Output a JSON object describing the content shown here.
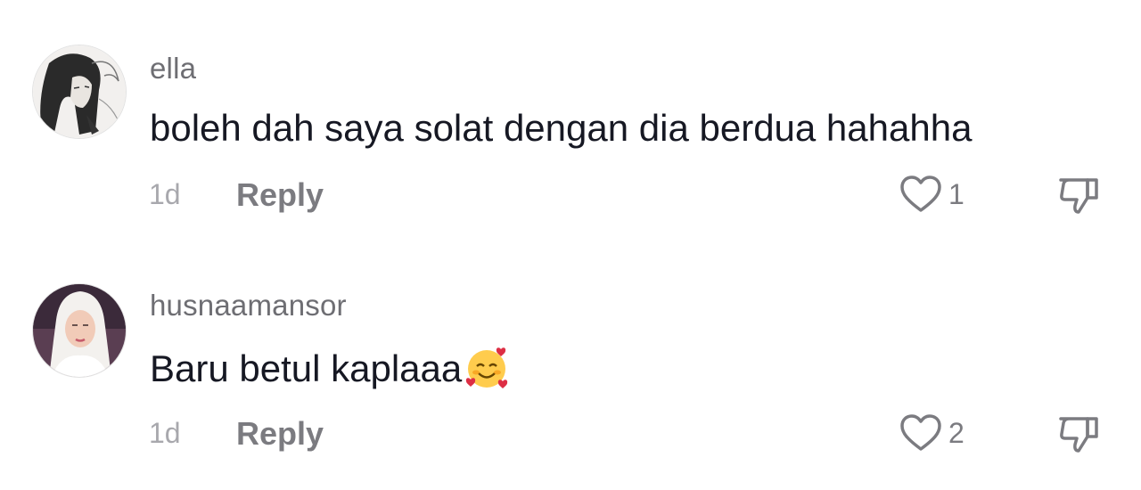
{
  "comments": [
    {
      "username": "ella",
      "text": "boleh dah saya solat dengan dia berdua hahahha",
      "time": "1d",
      "reply_label": "Reply",
      "like_count": "1",
      "avatar_icon": "avatar-anime-girl-icon"
    },
    {
      "username": "husnaamansor",
      "text": "Baru betul kaplaaa",
      "emoji": "smiling-face-with-hearts",
      "time": "1d",
      "reply_label": "Reply",
      "like_count": "2",
      "avatar_icon": "avatar-hijab-woman-icon"
    }
  ],
  "colors": {
    "username": "#6e6e73",
    "text": "#161823",
    "meta": "#a8a8ad",
    "reply": "#7b7b80"
  }
}
